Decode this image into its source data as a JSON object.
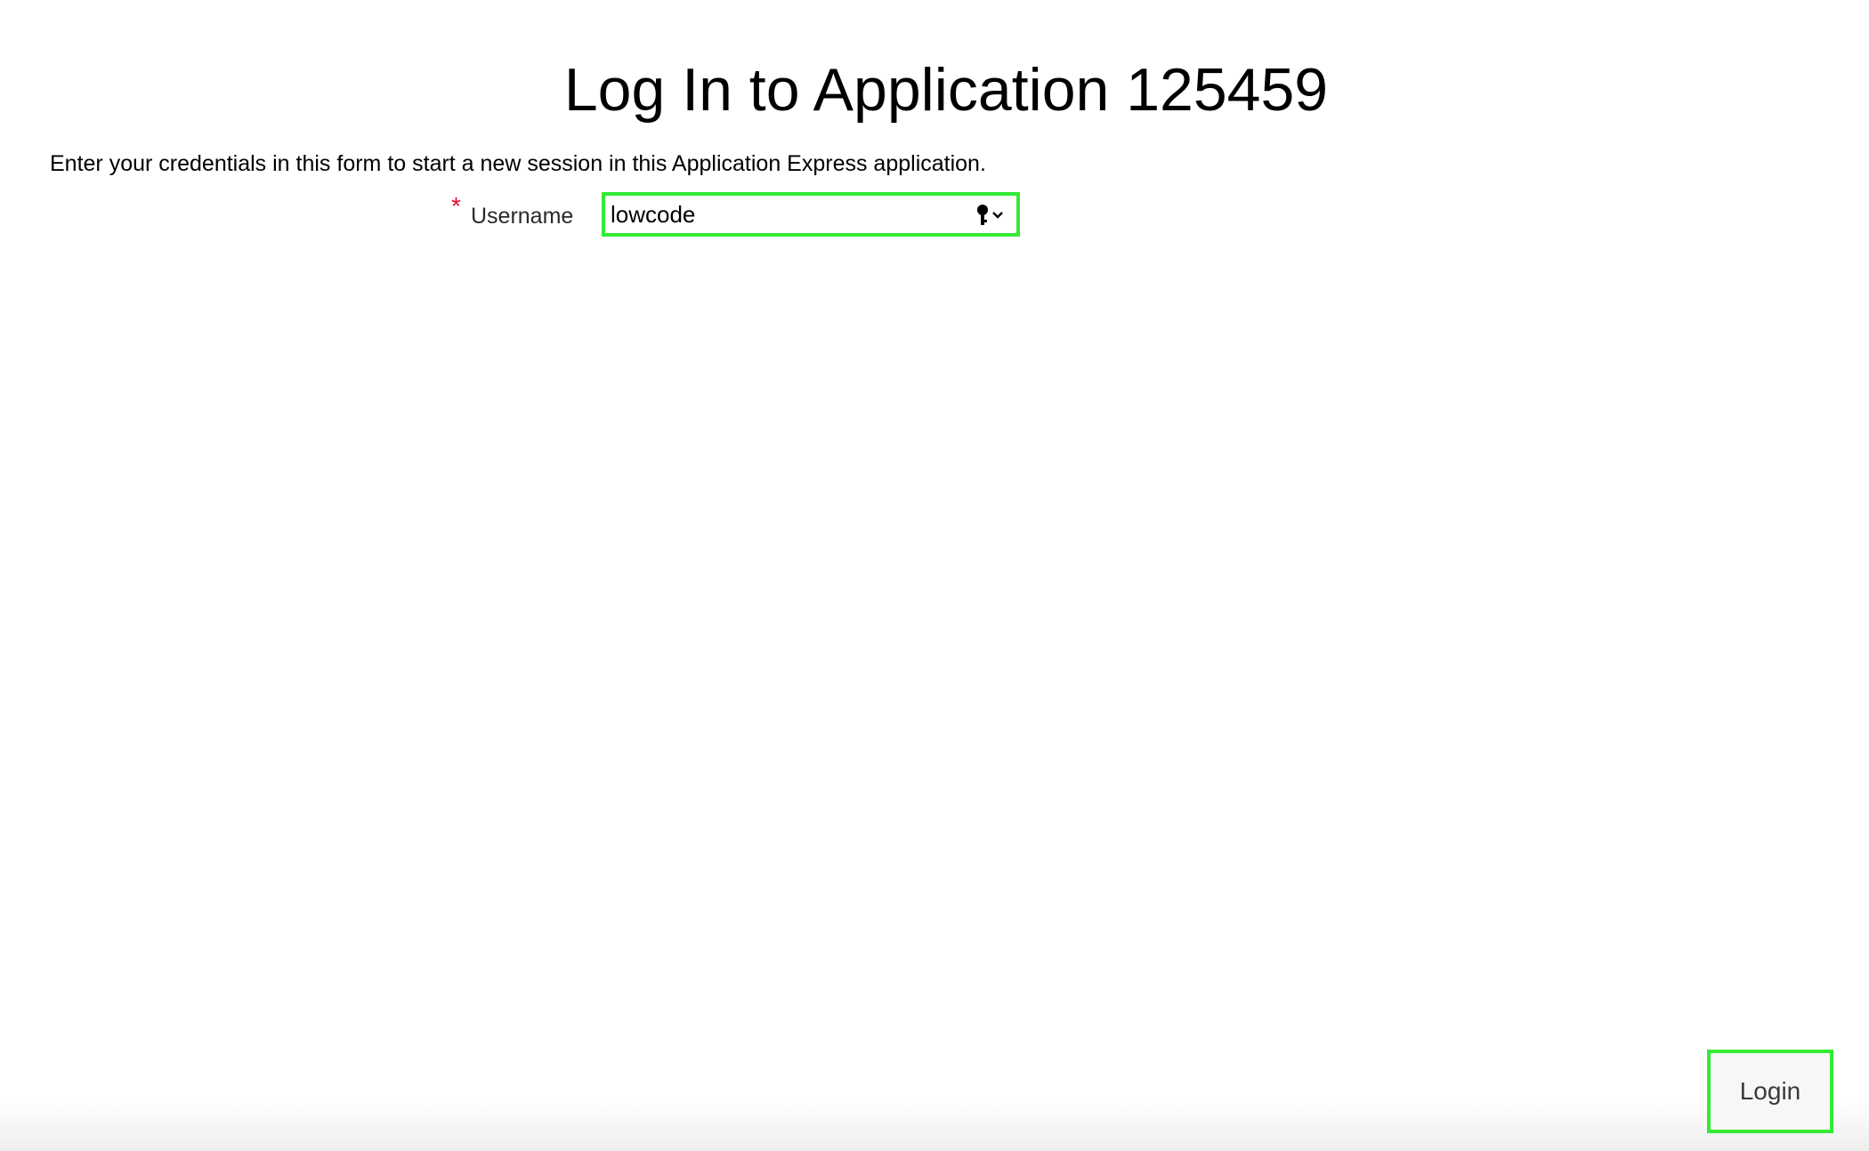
{
  "page": {
    "title": "Log In to Application 125459",
    "description": "Enter your credentials in this form to start a new session in this Application Express application."
  },
  "form": {
    "username": {
      "required_marker": "*",
      "label": "Username",
      "value": "lowcode"
    }
  },
  "actions": {
    "login_label": "Login"
  },
  "icons": {
    "autofill": "key-icon",
    "dropdown": "chevron-down-icon"
  },
  "colors": {
    "highlight": "#33ea35",
    "required": "#e0112b"
  }
}
